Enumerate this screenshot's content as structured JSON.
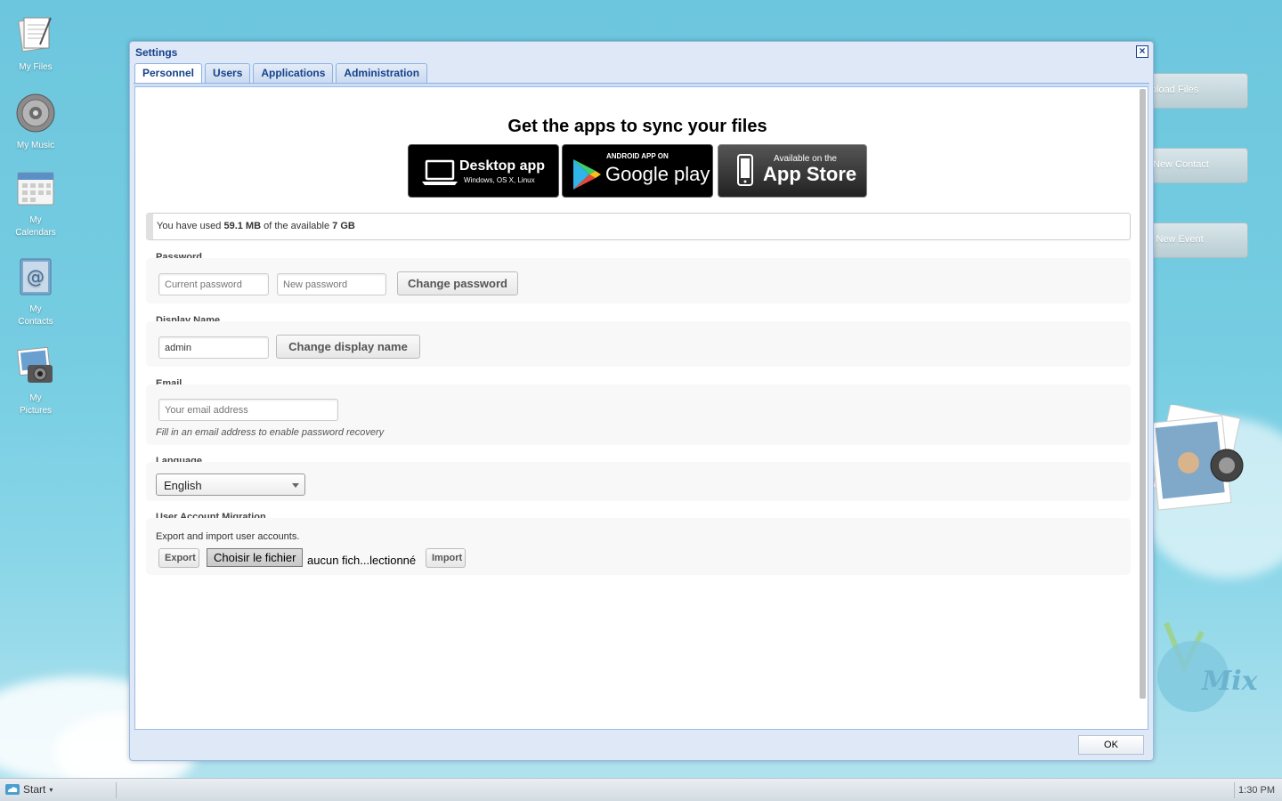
{
  "desktop": {
    "icons": [
      {
        "line1": "My Files",
        "line2": ""
      },
      {
        "line1": "My Music",
        "line2": ""
      },
      {
        "line1": "My",
        "line2": "Calendars"
      },
      {
        "line1": "My",
        "line2": "Contacts"
      },
      {
        "line1": "My",
        "line2": "Pictures"
      }
    ],
    "side_buttons": [
      "pload Files",
      "New Contact",
      "l New Event"
    ],
    "logo_text": "Mix"
  },
  "dialog": {
    "title": "Settings",
    "close": "×",
    "tabs": [
      "Personnel",
      "Users",
      "Applications",
      "Administration"
    ],
    "active_tab": "Personnel",
    "ok_label": "OK"
  },
  "apps": {
    "title": "Get the apps to sync your files",
    "desktop": {
      "big": "Desktop app",
      "small": "Windows, OS X, Linux"
    },
    "gplay": {
      "small": "ANDROID APP ON",
      "big": "Google play"
    },
    "appstore": {
      "small": "Available on the",
      "big": "App Store"
    }
  },
  "quota": {
    "prefix": "You have used",
    "used": "59.1 MB",
    "middle": "of the available",
    "total": "7 GB"
  },
  "password": {
    "label": "Password",
    "current_placeholder": "Current password",
    "new_placeholder": "New password",
    "button": "Change password"
  },
  "display_name": {
    "label": "Display Name",
    "value": "admin",
    "button": "Change display name"
  },
  "email": {
    "label": "Email",
    "placeholder": "Your email address",
    "hint": "Fill in an email address to enable password recovery"
  },
  "language": {
    "label": "Language",
    "selected": "English"
  },
  "migration": {
    "label": "User Account Migration",
    "description": "Export and import user accounts.",
    "export_button": "Export",
    "file_button": "Choisir le fichier",
    "file_status": "aucun fich...lectionné",
    "import_button": "Import"
  },
  "taskbar": {
    "start": "Start",
    "clock": "1:30 PM"
  },
  "colors": {
    "title_text": "#15428b",
    "dialog_bg": "#dfe8f6",
    "desktop_bg": "#76cde2"
  }
}
